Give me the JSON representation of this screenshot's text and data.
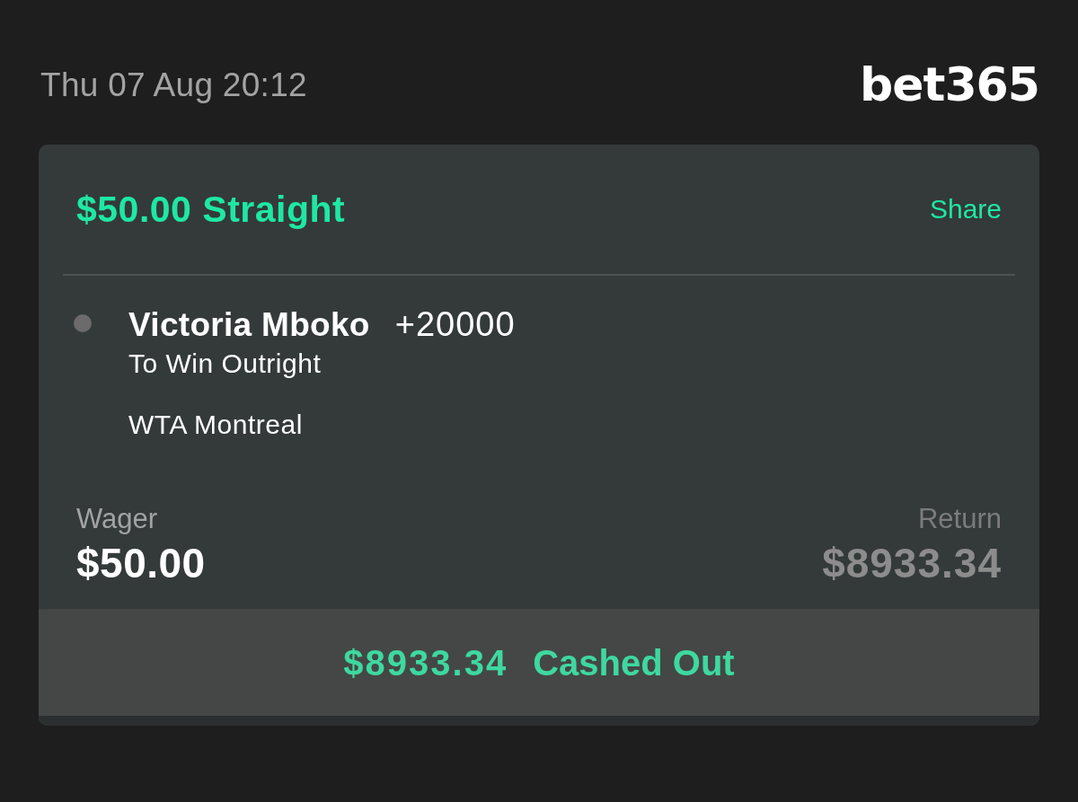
{
  "header": {
    "date": "Thu 07 Aug 20:12",
    "logo": "bet365"
  },
  "bet_card": {
    "title": "$50.00 Straight",
    "share": "Share",
    "selections": [
      {
        "name": "Victoria Mboko",
        "odds": "+20000",
        "market": "To Win Outright",
        "event": "WTA Montreal"
      }
    ],
    "wager": {
      "label": "Wager",
      "value": "$50.00"
    },
    "return": {
      "label": "Return",
      "value": "$8933.34"
    },
    "cash_out": {
      "amount": "$8933.34",
      "status": "Cashed Out"
    }
  }
}
